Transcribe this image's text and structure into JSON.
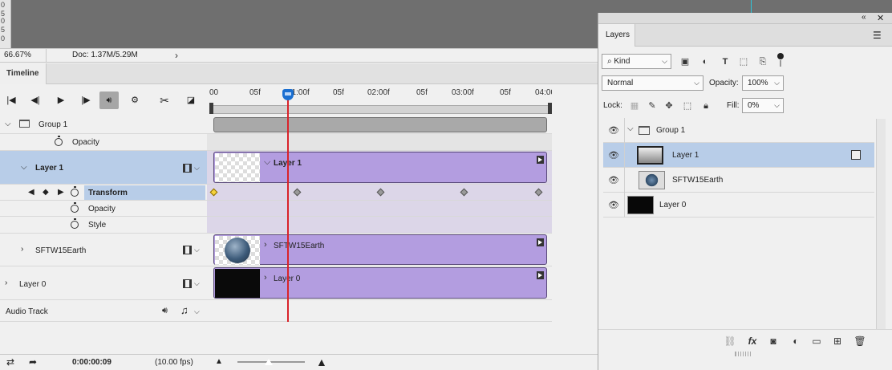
{
  "status_bar": {
    "zoom": "66.67%",
    "doc_info": "Doc: 1.37M/5.29M",
    "chevron": "›"
  },
  "timeline": {
    "tab_label": "Timeline",
    "ruler_labels": [
      "00",
      "05f",
      "01:00f",
      "05f",
      "02:00f",
      "05f",
      "03:00f",
      "05f",
      "04:00f"
    ],
    "current_time": "0:00:00:09",
    "fps": "(10.00 fps)",
    "rows": {
      "group1": "Group 1",
      "group1_opacity": "Opacity",
      "layer1": "Layer 1",
      "transform": "Transform",
      "opacity": "Opacity",
      "style": "Style",
      "sftw": "SFTW15Earth",
      "layer0": "Layer 0",
      "audio": "Audio Track"
    },
    "clips": {
      "layer1": "Layer 1",
      "sftw": "SFTW15Earth",
      "layer0": "Layer 0"
    }
  },
  "layers_panel": {
    "tab_label": "Layers",
    "filter_kind": "Kind",
    "blend_mode": "Normal",
    "opacity_label": "Opacity:",
    "opacity_value": "100%",
    "lock_label": "Lock:",
    "fill_label": "Fill:",
    "fill_value": "0%",
    "layers": [
      {
        "name": "Group 1"
      },
      {
        "name": "Layer 1"
      },
      {
        "name": "SFTW15Earth"
      },
      {
        "name": "Layer 0"
      }
    ]
  },
  "colors": {
    "clip": "#b39de0",
    "selected_row": "#b8cde8",
    "playhead": "#d9232a",
    "playhead_head": "#1a6fd1",
    "keyframe_selected": "#f5d33b"
  }
}
